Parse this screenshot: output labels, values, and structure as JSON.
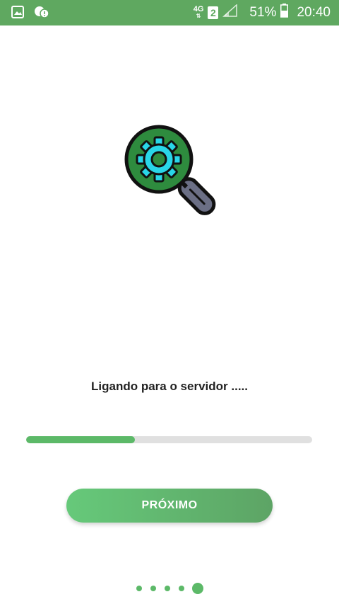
{
  "status_bar": {
    "icons_left": [
      "gallery-icon",
      "chat-notification-icon"
    ],
    "network_type": "4G",
    "sim_slot": "2",
    "battery_percent": "51%",
    "time": "20:40"
  },
  "illustration": {
    "icon": "magnifier-gear-icon",
    "colors": {
      "lens": "#2e8b3e",
      "gear": "#29d6e8",
      "handle": "#6b6f85"
    }
  },
  "main": {
    "status_text": "Ligando para o servidor .....",
    "progress": 0.38,
    "button_label": "PRÓXIMO"
  },
  "pager": {
    "total": 5,
    "active_index": 4
  },
  "colors": {
    "accent": "#5cb968",
    "status_bar": "#5fa860"
  }
}
